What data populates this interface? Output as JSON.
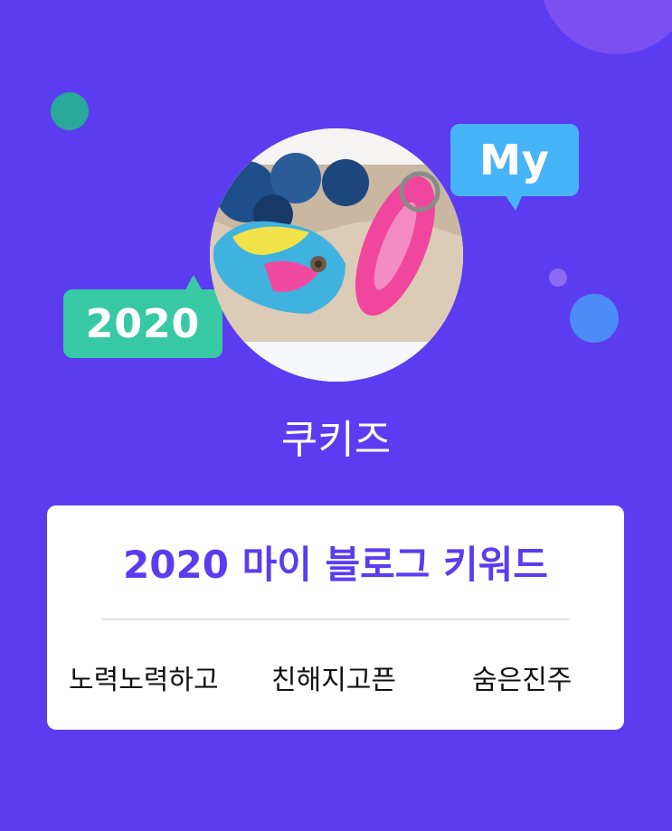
{
  "badges": {
    "my_label": "My",
    "year_label": "2020"
  },
  "profile": {
    "username": "쿠키즈",
    "avatar_icon": "profile-photo-keychains"
  },
  "keywords_card": {
    "title": "2020 마이 블로그 키워드",
    "keywords": [
      "노력노력하고",
      "친해지고픈",
      "숨은진주"
    ]
  },
  "colors": {
    "background": "#5b3cf0",
    "accent": "#5b3cf0",
    "my_bubble": "#47b4f7",
    "year_bubble": "#37c9a3"
  }
}
